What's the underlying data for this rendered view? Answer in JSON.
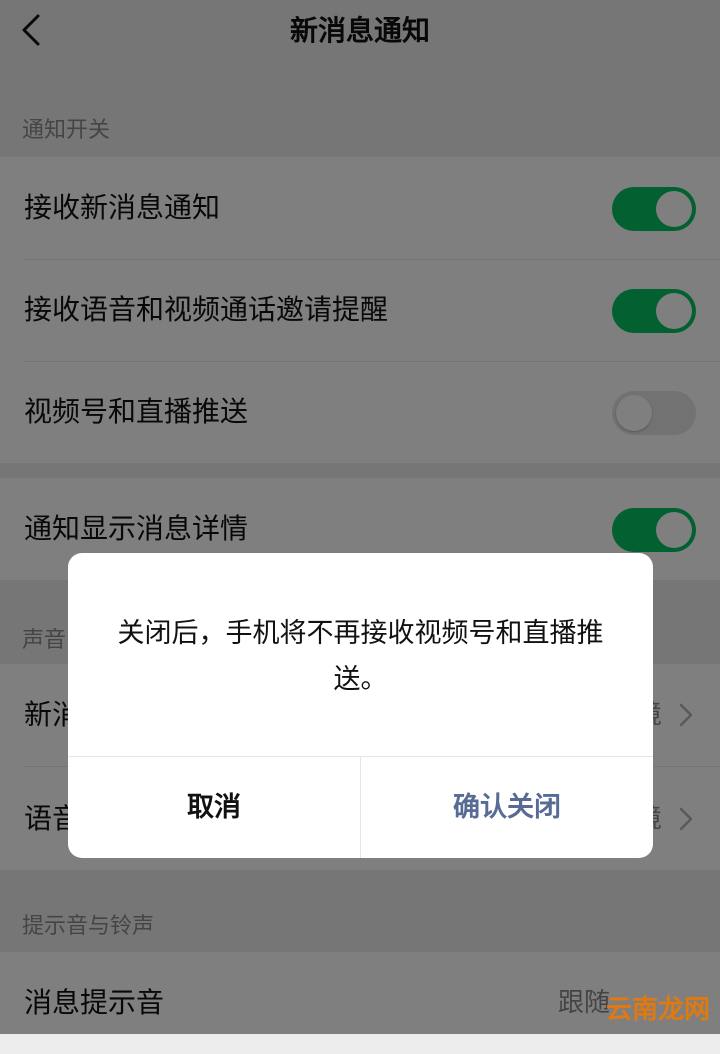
{
  "header": {
    "title": "新消息通知",
    "back_icon": "chevron-left-icon"
  },
  "sections": {
    "notify_switch": "通知开关",
    "sound_label": "声音",
    "ringtone_label": "提示音与铃声"
  },
  "rows": {
    "receive_new": {
      "label": "接收新消息通知",
      "on": true
    },
    "voice_video": {
      "label": "接收语音和视频通话邀请提醒",
      "on": true
    },
    "channels_live": {
      "label": "视频号和直播推送",
      "on": false
    },
    "show_detail": {
      "label": "通知显示消息详情",
      "on": true
    },
    "sound_new_partial": "新消",
    "sound_voice_partial": "语音",
    "sound_new_value_partial": "境",
    "sound_voice_value_partial": "境",
    "message_tone": {
      "label": "消息提示音",
      "value_partial": "跟随"
    }
  },
  "dialog": {
    "message": "关闭后，手机将不再接收视频号和直播推送。",
    "cancel": "取消",
    "confirm": "确认关闭"
  },
  "watermark": "云南龙网",
  "colors": {
    "toggle_on": "#07c160",
    "link_blue": "#576b95"
  }
}
